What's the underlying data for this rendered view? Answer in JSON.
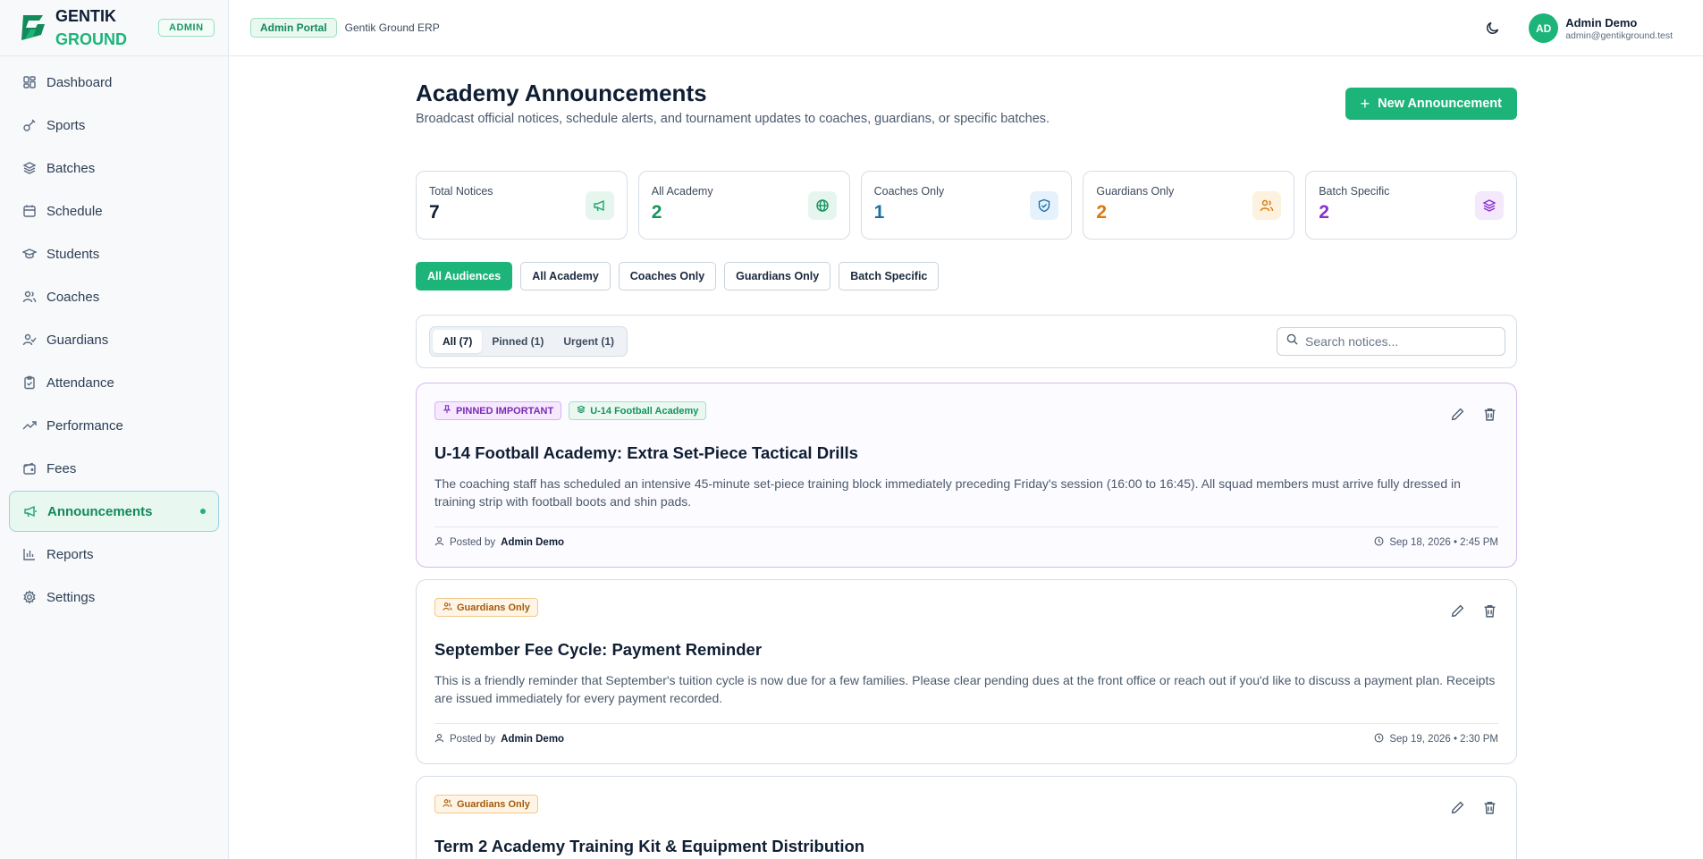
{
  "brand": {
    "line1": "GENTIK",
    "line2": "GROUND",
    "role": "ADMIN"
  },
  "topbar": {
    "portal": "Admin Portal",
    "subtitle": "Gentik Ground ERP",
    "user_initials": "AD",
    "user_name": "Admin Demo",
    "user_email": "admin@gentikground.test"
  },
  "sidebar": {
    "items": [
      {
        "label": "Dashboard",
        "icon": "dashboard-icon"
      },
      {
        "label": "Sports",
        "icon": "sports-icon"
      },
      {
        "label": "Batches",
        "icon": "layers-icon"
      },
      {
        "label": "Schedule",
        "icon": "calendar-icon"
      },
      {
        "label": "Students",
        "icon": "graduation-cap-icon"
      },
      {
        "label": "Coaches",
        "icon": "users-icon"
      },
      {
        "label": "Guardians",
        "icon": "user-check-icon"
      },
      {
        "label": "Attendance",
        "icon": "clipboard-check-icon"
      },
      {
        "label": "Performance",
        "icon": "trending-up-icon"
      },
      {
        "label": "Fees",
        "icon": "wallet-icon"
      },
      {
        "label": "Announcements",
        "icon": "megaphone-icon"
      },
      {
        "label": "Reports",
        "icon": "bar-chart-icon"
      },
      {
        "label": "Settings",
        "icon": "gear-icon"
      }
    ]
  },
  "page": {
    "title": "Academy Announcements",
    "subtitle": "Broadcast official notices, schedule alerts, and tournament updates to coaches, guardians, or specific batches.",
    "new_button": "New Announcement"
  },
  "stats": [
    {
      "label": "Total Notices",
      "value": "7",
      "color": "#0f1e33"
    },
    {
      "label": "All Academy",
      "value": "2",
      "color": "#15945f"
    },
    {
      "label": "Coaches Only",
      "value": "1",
      "color": "#1b6fa8"
    },
    {
      "label": "Guardians Only",
      "value": "2",
      "color": "#d97a0b"
    },
    {
      "label": "Batch Specific",
      "value": "2",
      "color": "#8a2fc9"
    }
  ],
  "filters": [
    "All Audiences",
    "All Academy",
    "Coaches Only",
    "Guardians Only",
    "Batch Specific"
  ],
  "segments": [
    "All (7)",
    "Pinned (1)",
    "Urgent (1)"
  ],
  "search": {
    "placeholder": "Search notices..."
  },
  "announcements": [
    {
      "tags": [
        "PINNED IMPORTANT",
        "U-14 Football Academy"
      ],
      "title": "U-14 Football Academy: Extra Set-Piece Tactical Drills",
      "body": "The coaching staff has scheduled an intensive 45-minute set-piece training block immediately preceding Friday's session (16:00 to 16:45). All squad members must arrive fully dressed in training strip with football boots and shin pads.",
      "posted_prefix": "Posted by",
      "author": "Admin Demo",
      "date": "Sep 18, 2026 • 2:45 PM"
    },
    {
      "tags": [
        "Guardians Only"
      ],
      "title": "September Fee Cycle: Payment Reminder",
      "body": "This is a friendly reminder that September's tuition cycle is now due for a few families. Please clear pending dues at the front office or reach out if you'd like to discuss a payment plan. Receipts are issued immediately for every payment recorded.",
      "posted_prefix": "Posted by",
      "author": "Admin Demo",
      "date": "Sep 19, 2026 • 2:30 PM"
    },
    {
      "tags": [
        "Guardians Only"
      ],
      "title": "Term 2 Academy Training Kit & Equipment Distribution"
    }
  ]
}
